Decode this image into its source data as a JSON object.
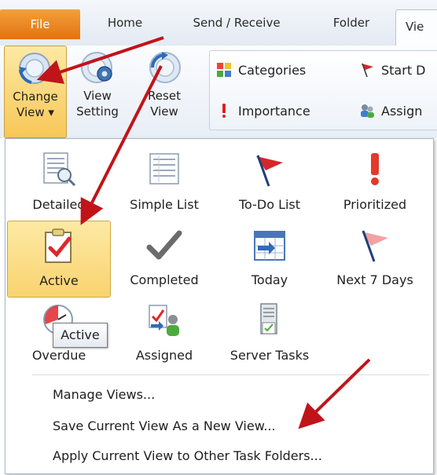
{
  "tabs": {
    "file": "File",
    "home": "Home",
    "send_receive": "Send / Receive",
    "folder": "Folder",
    "view": "Vie"
  },
  "ribbon": {
    "change_view": {
      "line1": "Change",
      "line2": "View ▾"
    },
    "view_setting": {
      "line1": "View",
      "line2": "Setting"
    },
    "reset_view": {
      "line1": "Reset",
      "line2": "View"
    },
    "categories": "Categories",
    "start_date": "Start D",
    "importance": "Importance",
    "assigned": "Assign"
  },
  "gallery": {
    "row1": [
      "Detailed",
      "Simple List",
      "To-Do List",
      "Prioritized"
    ],
    "row2": [
      "Active",
      "Completed",
      "Today",
      "Next 7 Days"
    ],
    "row3": [
      "Overdue",
      "Assigned",
      "Server Tasks"
    ],
    "selected": "Active",
    "tooltip": "Active"
  },
  "menu": {
    "manage_views": "Manage Views...",
    "save_current_view": "Save Current View As a New View...",
    "apply_current_view": "Apply Current View to Other Task Folders..."
  },
  "colors": {
    "file_tab": "#e27311",
    "selected_highlight": "#f9d36f",
    "annotation_arrow": "#c0141a"
  }
}
